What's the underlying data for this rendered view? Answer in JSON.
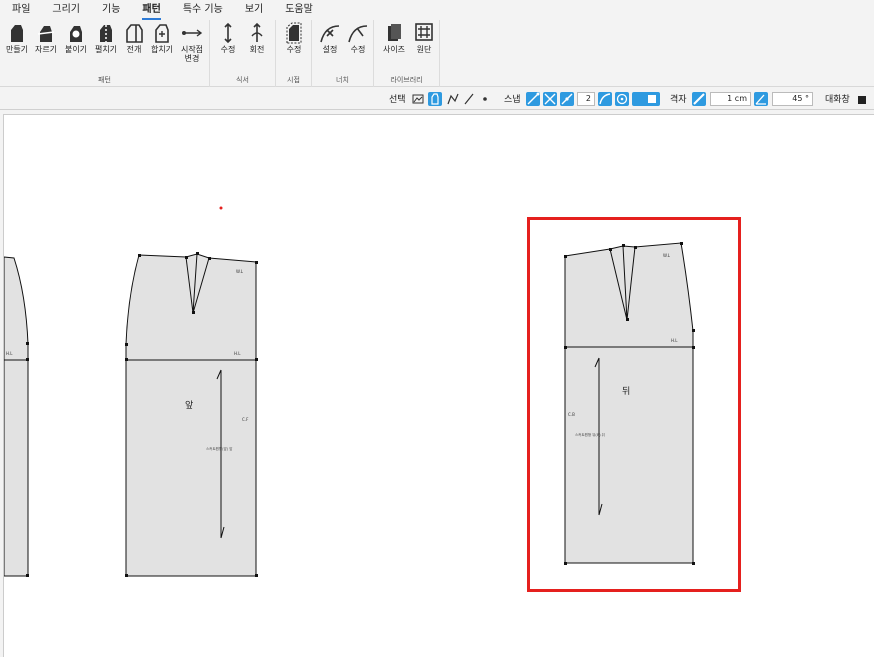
{
  "menu": {
    "items": [
      "파일",
      "그리기",
      "기능",
      "패턴",
      "특수 기능",
      "보기",
      "도움말"
    ],
    "active": "패턴"
  },
  "ribbon": {
    "pattern": {
      "label": "패턴",
      "tools": [
        "만들기",
        "자르기",
        "붙이기",
        "펼치기",
        "전개",
        "합치기",
        "시작점 변경"
      ]
    },
    "style": {
      "label": "식서",
      "tools": [
        "수정",
        "회전"
      ]
    },
    "notch": {
      "label": "시접",
      "tools": [
        "수정"
      ]
    },
    "dart": {
      "label": "너치",
      "tools": [
        "설정",
        "수정"
      ]
    },
    "library": {
      "label": "라이브러리",
      "tools": [
        "사이즈",
        "원단"
      ]
    }
  },
  "options": {
    "select_label": "선택",
    "snap_label": "스냅",
    "snap_value": "2",
    "grid_label": "격자",
    "grid_value": "1 cm",
    "angle_value": "45 °",
    "dialog_label": "대화창"
  },
  "pattern_pieces": {
    "front": {
      "title": "앞",
      "waist": "W.L",
      "hip": "H.L",
      "center": "C.F",
      "grain": "스커트원형(앞) 앞"
    },
    "back": {
      "title": "뒤",
      "waist": "W.L",
      "hip": "H.L",
      "center": "C.B",
      "grain": "스커트원형 뒤(B) 뒤"
    },
    "partial": {
      "hip": "H.L"
    }
  },
  "colors": {
    "accent": "#2e7bd6",
    "tool_blue": "#2e9ae0",
    "selection": "#e5201e",
    "piece_fill": "#e2e2e2"
  }
}
